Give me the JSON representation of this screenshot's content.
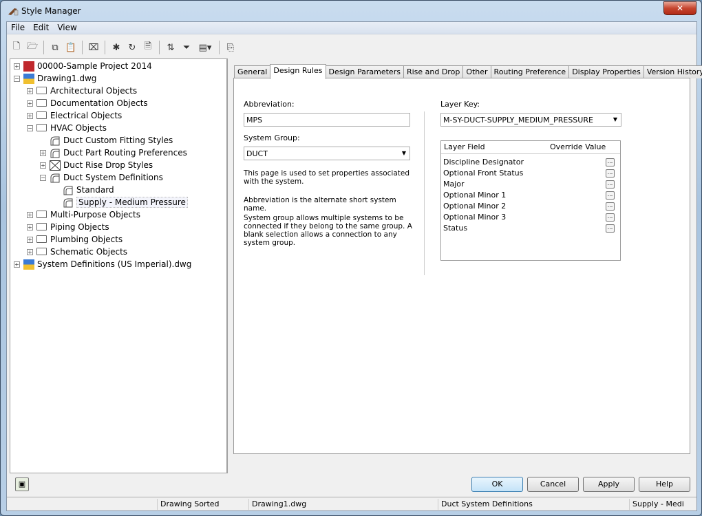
{
  "window": {
    "title": "Style Manager",
    "close": "✕"
  },
  "menu": [
    "File",
    "Edit",
    "View"
  ],
  "toolbar": [
    "new-icon",
    "open-icon",
    "copy-icon",
    "paste-icon",
    "purge-icon",
    "new-style-icon",
    "edit-style-icon",
    "set-from-icon",
    "sort-icon",
    "filter-icon",
    "view-icon",
    "toggle-view-icon"
  ],
  "tree": [
    {
      "label": "00000-Sample Project 2014",
      "level": 0,
      "exp": "+",
      "icon": "project"
    },
    {
      "label": "Drawing1.dwg",
      "level": 0,
      "exp": "−",
      "icon": "dwg"
    },
    {
      "label": "Architectural Objects",
      "level": 1,
      "exp": "+",
      "icon": "folder"
    },
    {
      "label": "Documentation Objects",
      "level": 1,
      "exp": "+",
      "icon": "folder"
    },
    {
      "label": "Electrical Objects",
      "level": 1,
      "exp": "+",
      "icon": "folder"
    },
    {
      "label": "HVAC Objects",
      "level": 1,
      "exp": "−",
      "icon": "folder"
    },
    {
      "label": "Duct Custom Fitting Styles",
      "level": 2,
      "exp": "",
      "icon": "style"
    },
    {
      "label": "Duct Part Routing Preferences",
      "level": 2,
      "exp": "+",
      "icon": "style"
    },
    {
      "label": "Duct Rise Drop Styles",
      "level": 2,
      "exp": "+",
      "icon": "box"
    },
    {
      "label": "Duct System Definitions",
      "level": 2,
      "exp": "−",
      "icon": "style"
    },
    {
      "label": "Standard",
      "level": 3,
      "exp": "",
      "icon": "style"
    },
    {
      "label": "Supply - Medium Pressure",
      "level": 3,
      "exp": "",
      "icon": "style",
      "selected": true
    },
    {
      "label": "Multi-Purpose Objects",
      "level": 1,
      "exp": "+",
      "icon": "folder"
    },
    {
      "label": "Piping Objects",
      "level": 1,
      "exp": "+",
      "icon": "folder"
    },
    {
      "label": "Plumbing Objects",
      "level": 1,
      "exp": "+",
      "icon": "folder"
    },
    {
      "label": "Schematic Objects",
      "level": 1,
      "exp": "+",
      "icon": "folder"
    },
    {
      "label": "System Definitions (US Imperial).dwg",
      "level": 0,
      "exp": "+",
      "icon": "dwg"
    }
  ],
  "tabs": [
    "General",
    "Design Rules",
    "Design Parameters",
    "Rise and Drop",
    "Other",
    "Routing Preference",
    "Display Properties",
    "Version History"
  ],
  "active_tab": 1,
  "form": {
    "abbrev_label": "Abbreviation:",
    "abbrev_value": "MPS",
    "group_label": "System Group:",
    "group_value": "DUCT",
    "desc1": "This page is used to set properties associated with the system.",
    "desc2": "Abbreviation is the alternate short system name.",
    "desc3": "System group allows multiple systems to be connected if they belong to the same group. A blank selection allows a connection to any system group.",
    "layerkey_label": "Layer Key:",
    "layerkey_value": "M-SY-DUCT-SUPPLY_MEDIUM_PRESSURE",
    "grid_headers": [
      "Layer Field",
      "Override Value"
    ],
    "grid_rows": [
      "Discipline Designator",
      "Optional Front Status",
      "Major",
      "Optional Minor 1",
      "Optional Minor 2",
      "Optional Minor 3",
      "Status"
    ],
    "ellipsis": "..."
  },
  "buttons": {
    "ok": "OK",
    "cancel": "Cancel",
    "apply": "Apply",
    "help": "Help"
  },
  "status": [
    "Drawing Sorted",
    "Drawing1.dwg",
    "Duct System Definitions",
    "Supply - Medi"
  ]
}
